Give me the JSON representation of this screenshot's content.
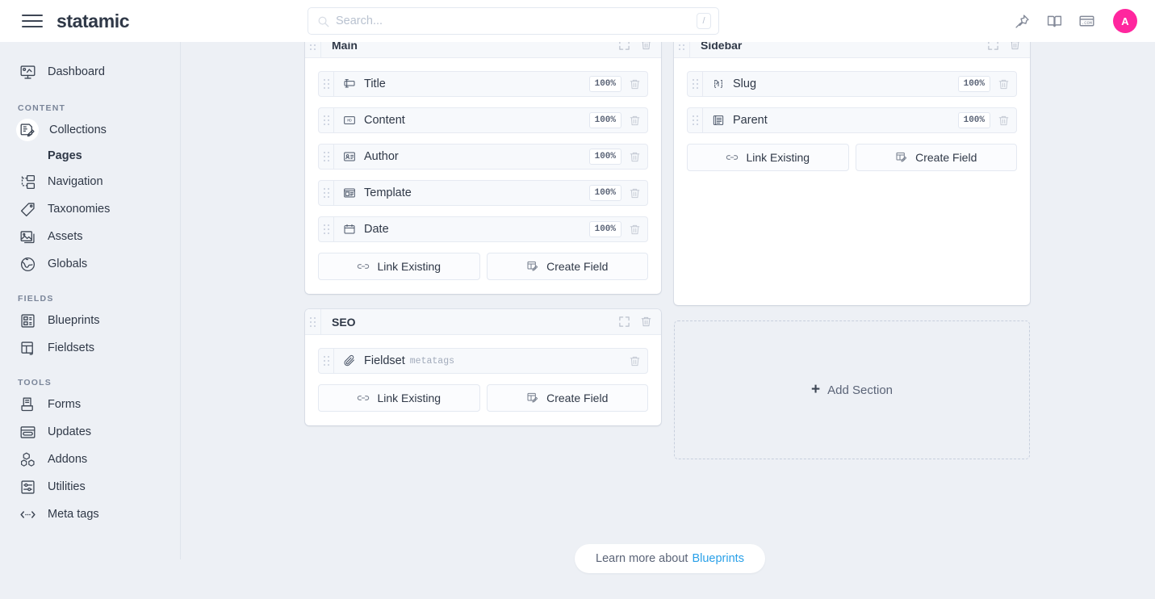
{
  "topbar": {
    "brand": "statamic",
    "menu_icon": "hamburger-icon",
    "search": {
      "placeholder": "Search...",
      "value": "",
      "shortcut": "/"
    },
    "icons": [
      "pin-icon",
      "book-icon",
      "dot-com-icon"
    ],
    "avatar_initial": "A",
    "avatar_color": "#ff269e"
  },
  "sidebar": {
    "top_items": [
      {
        "label": "Dashboard",
        "icon": "dashboard-icon"
      }
    ],
    "groups": [
      {
        "heading": "CONTENT",
        "items": [
          {
            "label": "Collections",
            "icon": "collections-icon",
            "active": true,
            "children": [
              {
                "label": "Pages"
              }
            ]
          },
          {
            "label": "Navigation",
            "icon": "navigation-icon"
          },
          {
            "label": "Taxonomies",
            "icon": "taxonomies-icon"
          },
          {
            "label": "Assets",
            "icon": "assets-icon"
          },
          {
            "label": "Globals",
            "icon": "globals-icon"
          }
        ]
      },
      {
        "heading": "FIELDS",
        "items": [
          {
            "label": "Blueprints",
            "icon": "blueprints-icon"
          },
          {
            "label": "Fieldsets",
            "icon": "fieldsets-icon"
          }
        ]
      },
      {
        "heading": "TOOLS",
        "items": [
          {
            "label": "Forms",
            "icon": "forms-icon"
          },
          {
            "label": "Updates",
            "icon": "updates-icon"
          },
          {
            "label": "Addons",
            "icon": "addons-icon"
          },
          {
            "label": "Utilities",
            "icon": "utilities-icon"
          },
          {
            "label": "Meta tags",
            "icon": "meta-tags-icon"
          }
        ]
      }
    ]
  },
  "blueprint": {
    "sections": [
      {
        "title": "Main",
        "fields": [
          {
            "label": "Title",
            "icon": "text-field-icon",
            "width": "100%"
          },
          {
            "label": "Content",
            "icon": "markdown-field-icon",
            "width": "100%"
          },
          {
            "label": "Author",
            "icon": "users-field-icon",
            "width": "100%"
          },
          {
            "label": "Template",
            "icon": "template-field-icon",
            "width": "100%"
          },
          {
            "label": "Date",
            "icon": "date-field-icon",
            "width": "100%"
          }
        ],
        "link_existing_label": "Link Existing",
        "create_field_label": "Create Field"
      },
      {
        "title": "Sidebar",
        "fields": [
          {
            "label": "Slug",
            "icon": "slug-field-icon",
            "width": "100%"
          },
          {
            "label": "Parent",
            "icon": "parent-field-icon",
            "width": "100%"
          }
        ],
        "link_existing_label": "Link Existing",
        "create_field_label": "Create Field"
      },
      {
        "title": "SEO",
        "fields": [
          {
            "label": "Fieldset",
            "sub": "metatags",
            "icon": "fieldset-icon"
          }
        ],
        "link_existing_label": "Link Existing",
        "create_field_label": "Create Field"
      }
    ],
    "add_section_label": "Add Section"
  },
  "footer": {
    "text": "Learn more about",
    "link": "Blueprints",
    "link_color": "#29a0e8"
  }
}
